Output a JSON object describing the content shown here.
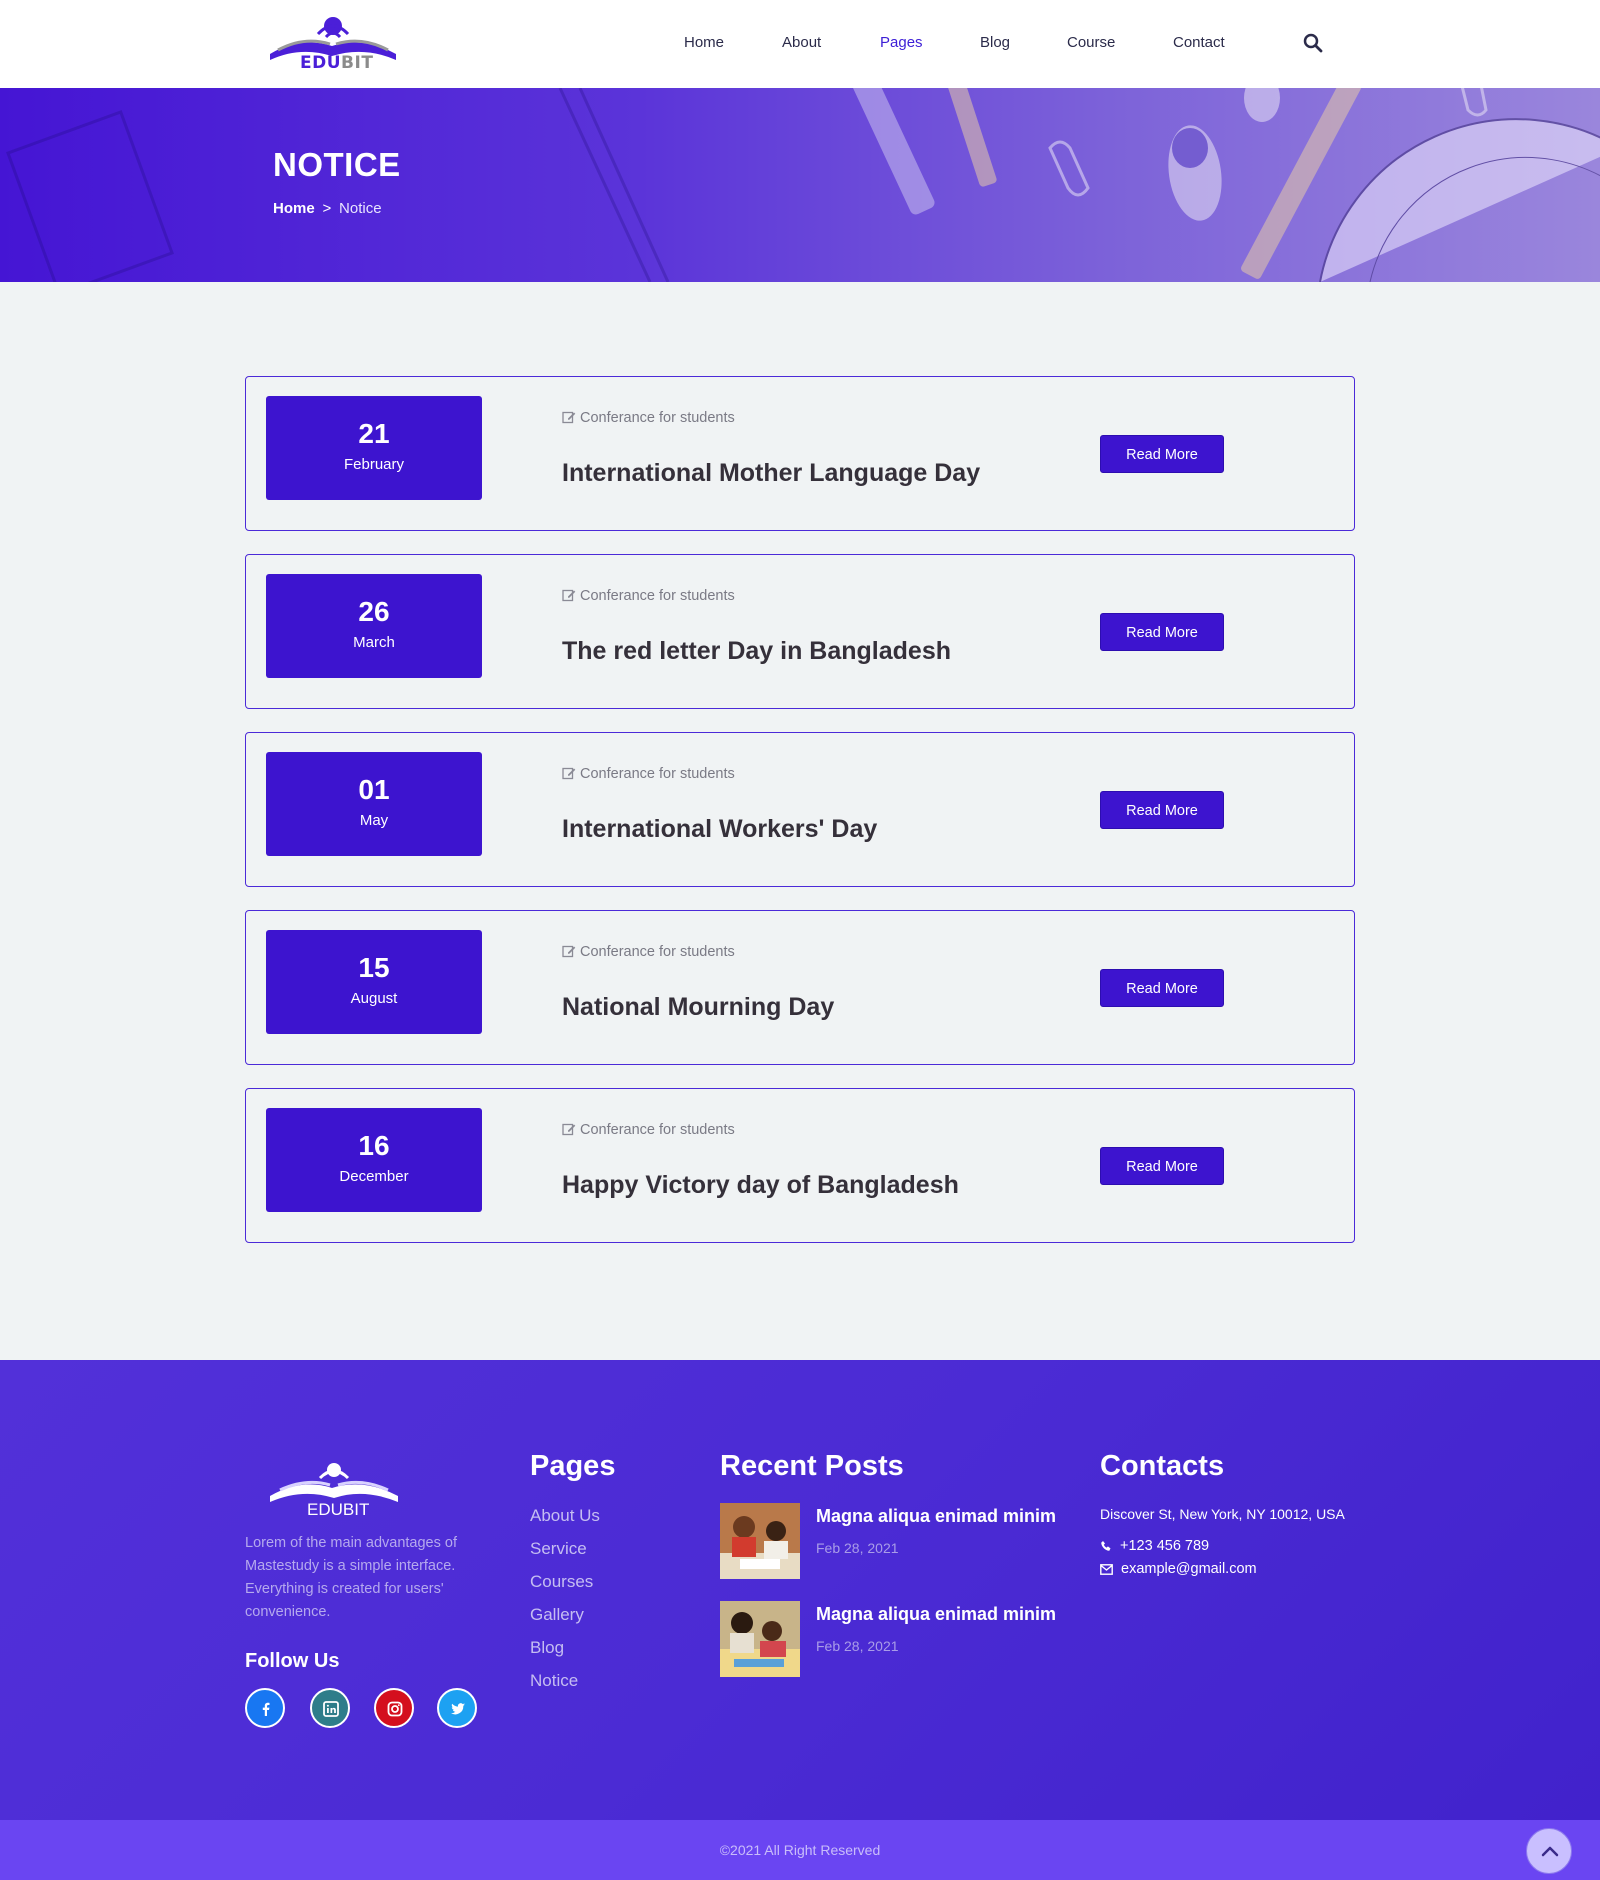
{
  "header": {
    "logo": {
      "part1": "EDU",
      "part2": "BIT"
    },
    "nav": [
      {
        "label": "Home",
        "active": false
      },
      {
        "label": "About",
        "active": false
      },
      {
        "label": "Pages",
        "active": true
      },
      {
        "label": "Blog",
        "active": false
      },
      {
        "label": "Course",
        "active": false
      },
      {
        "label": "Contact",
        "active": false
      }
    ],
    "search_icon": "search-icon"
  },
  "banner": {
    "title": "NOTICE",
    "breadcrumb": {
      "home": "Home",
      "separator": ">",
      "current": "Notice"
    }
  },
  "notices": [
    {
      "day": "21",
      "month": "February",
      "tag": "Conferance for students",
      "title": "International Mother Language Day",
      "button": "Read More"
    },
    {
      "day": "26",
      "month": "March",
      "tag": "Conferance for students",
      "title": "The red letter Day in Bangladesh",
      "button": "Read More"
    },
    {
      "day": "01",
      "month": "May",
      "tag": "Conferance for students",
      "title": "International Workers' Day",
      "button": "Read More"
    },
    {
      "day": "15",
      "month": "August",
      "tag": "Conferance for students",
      "title": "National Mourning Day",
      "button": "Read More"
    },
    {
      "day": "16",
      "month": "December",
      "tag": "Conferance for students",
      "title": "Happy Victory day of Bangladesh",
      "button": "Read More"
    }
  ],
  "footer": {
    "logo_text": "EDUBIT",
    "about": "Lorem of the main advantages of Mastestudy is a simple interface. Everything is created for users' convenience.",
    "follow_us": "Follow Us",
    "social": [
      {
        "name": "facebook-icon",
        "color": "#1877f2"
      },
      {
        "name": "linkedin-icon",
        "color": "#2e7d8a"
      },
      {
        "name": "instagram-icon",
        "color": "#d40f1e"
      },
      {
        "name": "twitter-icon",
        "color": "#1da1f2"
      }
    ],
    "pages": {
      "heading": "Pages",
      "links": [
        "About Us",
        "Service",
        "Courses",
        "Gallery",
        "Blog",
        "Notice"
      ]
    },
    "recent_posts": {
      "heading": "Recent Posts",
      "posts": [
        {
          "title": "Magna aliqua enimad minim",
          "date": "Feb 28, 2021"
        },
        {
          "title": "Magna aliqua enimad minim",
          "date": "Feb 28, 2021"
        }
      ]
    },
    "contacts": {
      "heading": "Contacts",
      "address": "Discover St, New York, NY 10012, USA",
      "phone": "+123 456 789",
      "email": "example@gmail.com"
    },
    "copyright": "©2021 All Right Reserved"
  },
  "colors": {
    "primary": "#3d14cf",
    "footer": "#4b2bd4",
    "bottom_bar": "#6a45f2"
  }
}
